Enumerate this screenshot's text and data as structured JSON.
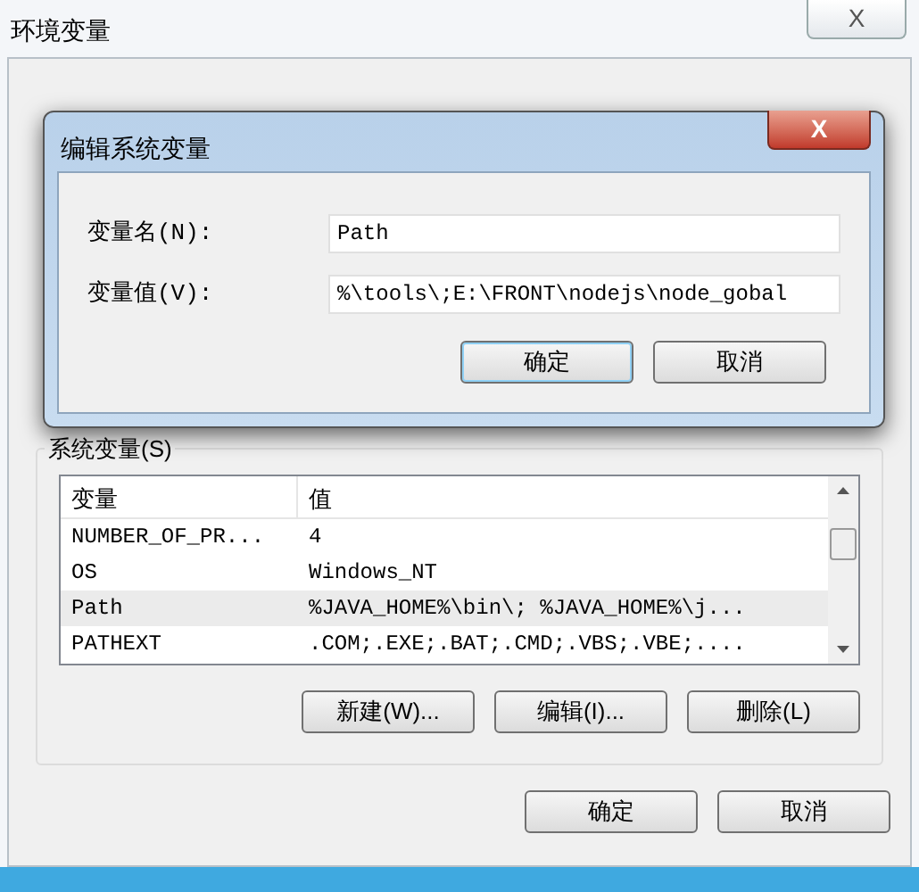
{
  "window": {
    "title": "环境变量",
    "close": "X"
  },
  "edit_dialog": {
    "title": "编辑系统变量",
    "close": "X",
    "fields": [
      {
        "label": "变量名(N):",
        "value": "Path"
      },
      {
        "label": "变量值(V):",
        "value": "%\\tools\\;E:\\FRONT\\nodejs\\node_gobal"
      }
    ],
    "buttons": [
      {
        "label": "确定",
        "default": true
      },
      {
        "label": "取消",
        "default": false
      }
    ]
  },
  "system_variables": {
    "title": "系统变量(S)",
    "columns": [
      "变量",
      "值"
    ],
    "rows": [
      {
        "name": "NUMBER_OF_PR...",
        "value": "4",
        "selected": false
      },
      {
        "name": "OS",
        "value": "Windows_NT",
        "selected": false
      },
      {
        "name": "Path",
        "value": "%JAVA_HOME%\\bin\\; %JAVA_HOME%\\j...",
        "selected": true
      },
      {
        "name": "PATHEXT",
        "value": ".COM;.EXE;.BAT;.CMD;.VBS;.VBE;....",
        "selected": false
      }
    ],
    "buttons": [
      "新建(W)...",
      "编辑(I)...",
      "删除(L)"
    ]
  },
  "buttons": [
    "确定",
    "取消"
  ]
}
